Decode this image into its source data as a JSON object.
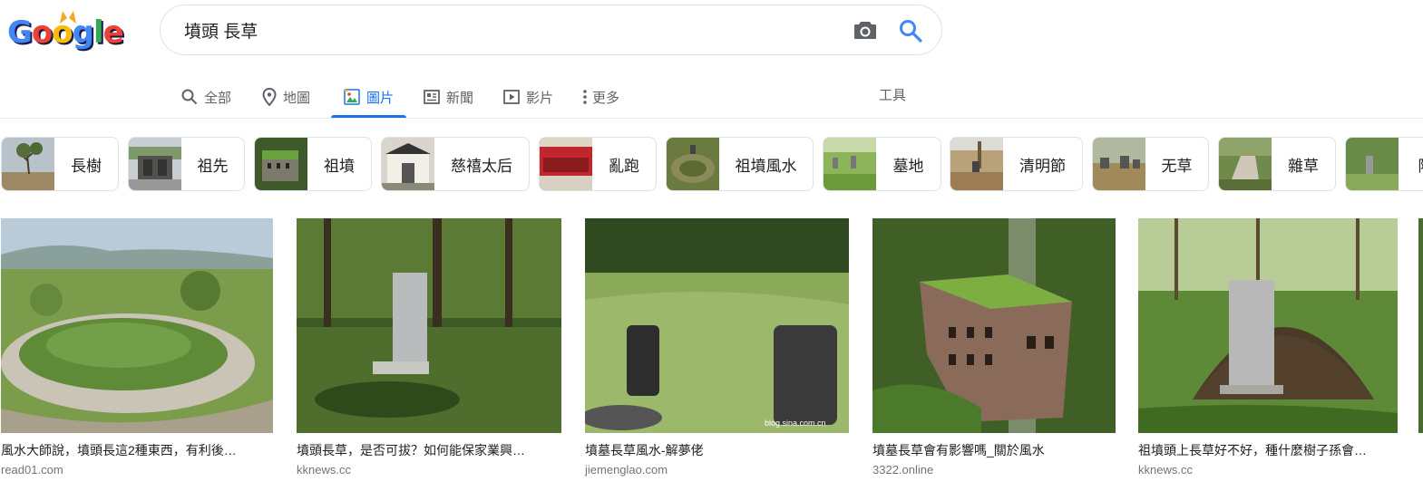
{
  "logo": {
    "letters": [
      "G",
      "o",
      "o",
      "g",
      "l",
      "e"
    ],
    "colors": [
      "#4285f4",
      "#ea4335",
      "#fbbc05",
      "#4285f4",
      "#34a853",
      "#ea4335"
    ]
  },
  "search": {
    "query": "墳頭 長草",
    "camera_icon": "camera-icon",
    "search_icon": "search-icon"
  },
  "tabs": [
    {
      "label": "全部",
      "icon": "search-icon"
    },
    {
      "label": "地圖",
      "icon": "map-pin-icon"
    },
    {
      "label": "圖片",
      "icon": "image-icon"
    },
    {
      "label": "新聞",
      "icon": "news-icon"
    },
    {
      "label": "影片",
      "icon": "video-icon"
    },
    {
      "label": "更多",
      "icon": "more-vert-icon"
    }
  ],
  "tools_label": "工具",
  "chips": [
    "長樹",
    "祖先",
    "祖墳",
    "慈禧太后",
    "亂跑",
    "祖墳風水",
    "墓地",
    "清明節",
    "无草",
    "雜草",
    "陰"
  ],
  "results": [
    {
      "caption": "風水大師說，墳頭長這2種東西，有利後…",
      "source": "read01.com"
    },
    {
      "caption": "墳頭長草，是否可拔？如何能保家業興…",
      "source": "kknews.cc"
    },
    {
      "caption": "墳墓長草風水-解夢佬",
      "source": "jiemenglao.com"
    },
    {
      "caption": "墳墓長草會有影響嗎_關於風水",
      "source": "3322.online"
    },
    {
      "caption": "祖墳頭上長草好不好，種什麼樹子孫會…",
      "source": "kknews.cc"
    }
  ],
  "watermark": "blog.sina.com.cn",
  "colors": {
    "accent": "#1a73e8",
    "text": "#202124",
    "muted": "#5f6368",
    "source": "#70757a"
  }
}
